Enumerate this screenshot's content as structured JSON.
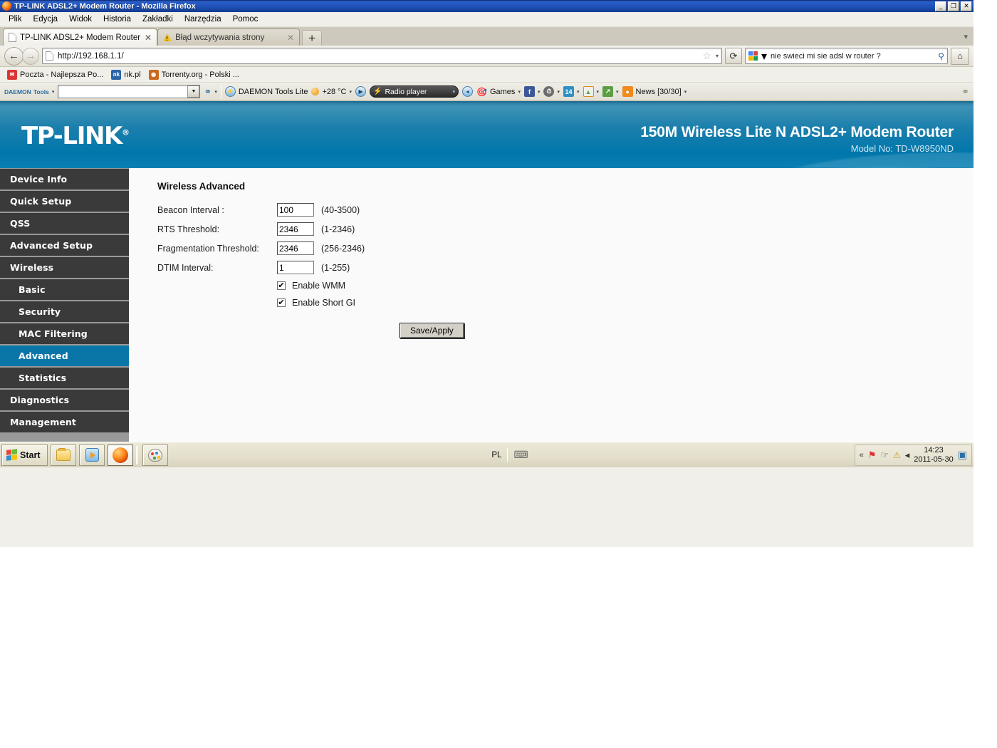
{
  "window": {
    "title": "TP-LINK ADSL2+ Modem Router - Mozilla Firefox",
    "minimize": "_",
    "maximize": "❐",
    "close": "✕"
  },
  "menubar": {
    "items": [
      "Plik",
      "Edycja",
      "Widok",
      "Historia",
      "Zakładki",
      "Narzędzia",
      "Pomoc"
    ]
  },
  "tabs": [
    {
      "label": "TP-LINK ADSL2+ Modem Router",
      "close": "✕",
      "active": true
    },
    {
      "label": "Błąd wczytywania strony",
      "close": "✕",
      "active": false
    }
  ],
  "tabbar": {
    "newtab": "+",
    "list_arrow": "▾"
  },
  "navigation": {
    "back": "←",
    "forward": "→",
    "url": "http://192.168.1.1/",
    "star": "☆",
    "star_caret": "▾",
    "reload": "⟳",
    "home": "⌂"
  },
  "search": {
    "engine_caret": "▾",
    "query": "nie swieci mi sie adsl w router ?",
    "go": "⚲"
  },
  "bookmarks": [
    {
      "label": "Poczta - Najlepsza Po...",
      "icon": "mail-icon",
      "color": "#d33",
      "glyph": "✉"
    },
    {
      "label": "nk.pl",
      "icon": "nk-icon",
      "color": "#2a63a8",
      "glyph": "nk"
    },
    {
      "label": "Torrenty.org - Polski ...",
      "icon": "torrent-icon",
      "color": "#c96a1d",
      "glyph": "◉"
    }
  ],
  "addonbar": {
    "daemon_line1": "DAEMON",
    "daemon_line2": "Tools",
    "daemon_caret": "▾",
    "combo_arrow": "▼",
    "search_caret": "▾",
    "divider": "❙",
    "daemon_tools_lite": "DAEMON Tools Lite",
    "weather": "+28 °C",
    "weather_caret": "▾",
    "play": "▶",
    "radio_player": "Radio player",
    "radio_caret": "▾",
    "speaker": "◂",
    "games": "Games",
    "games_caret": "▾",
    "facebook": "f",
    "fb_caret": "▾",
    "clock_caret": "▾",
    "calendar": "14",
    "cal_caret": "▾",
    "image_caret": "▾",
    "upload_caret": "▾",
    "rss": "◉",
    "news": "News [30/30]",
    "news_caret": "▾"
  },
  "router": {
    "banner": {
      "logo": "TP-LINK",
      "logo_mark": "®",
      "product": "150M Wireless Lite N ADSL2+ Modem Router",
      "model": "Model No: TD-W8950ND",
      "accent_color": "#0076ab"
    },
    "sidebar": {
      "items": [
        {
          "label": "Device Info",
          "sub": false,
          "active": false
        },
        {
          "label": "Quick Setup",
          "sub": false,
          "active": false
        },
        {
          "label": "QSS",
          "sub": false,
          "active": false
        },
        {
          "label": "Advanced Setup",
          "sub": false,
          "active": false
        },
        {
          "label": "Wireless",
          "sub": false,
          "active": false
        },
        {
          "label": "Basic",
          "sub": true,
          "active": false
        },
        {
          "label": "Security",
          "sub": true,
          "active": false
        },
        {
          "label": "MAC Filtering",
          "sub": true,
          "active": false
        },
        {
          "label": "Advanced",
          "sub": true,
          "active": true
        },
        {
          "label": "Statistics",
          "sub": true,
          "active": false
        },
        {
          "label": "Diagnostics",
          "sub": false,
          "active": false
        },
        {
          "label": "Management",
          "sub": false,
          "active": false
        }
      ],
      "active_color": "#0a76a8"
    },
    "content": {
      "title": "Wireless Advanced",
      "fields": [
        {
          "label": "Beacon Interval :",
          "value": "100",
          "range": "(40-3500)"
        },
        {
          "label": "RTS Threshold:",
          "value": "2346",
          "range": "(1-2346)"
        },
        {
          "label": "Fragmentation Threshold:",
          "value": "2346",
          "range": "(256-2346)"
        },
        {
          "label": "DTIM Interval:",
          "value": "1",
          "range": "(1-255)"
        }
      ],
      "checkboxes": [
        {
          "label": "Enable WMM",
          "checked": true,
          "mark": "✔"
        },
        {
          "label": "Enable Short GI",
          "checked": true,
          "mark": "✔"
        }
      ],
      "save_button": "Save/Apply"
    }
  },
  "taskbar": {
    "start": "Start",
    "buttons": [
      {
        "name": "explorer",
        "icon": "folder-icon"
      },
      {
        "name": "media-player",
        "icon": "media-icon"
      },
      {
        "name": "firefox",
        "icon": "firefox-icon",
        "active": true
      },
      {
        "name": "paint",
        "icon": "paint-icon"
      }
    ],
    "tray": {
      "language": "PL",
      "keyboard": "⌨",
      "expand": "«",
      "network_error": "⚑",
      "usb": "☞",
      "shield_warn": "⚠",
      "volume": "◂",
      "time": "14:23",
      "date": "2011-05-30",
      "monitor": "▣"
    }
  }
}
